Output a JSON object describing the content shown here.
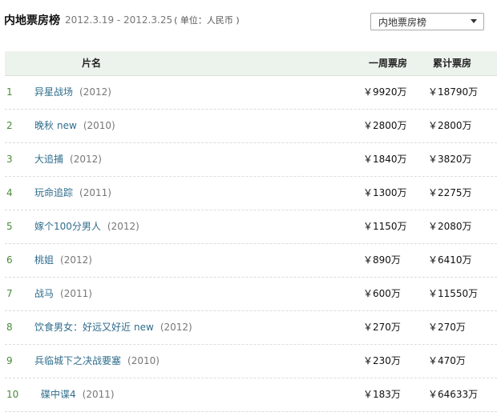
{
  "header": {
    "title": "内地票房榜",
    "dates": "2012.3.19 - 2012.3.25",
    "unit": "( 单位：人民币 )"
  },
  "selector": {
    "selected": "内地票房榜",
    "icon": "chevron-down-icon"
  },
  "table": {
    "columns": {
      "name": "片名",
      "week": "一周票房",
      "total": "累计票房"
    },
    "rows": [
      {
        "rank": "1",
        "title": "异星战场",
        "tag": "",
        "year": "(2012)",
        "week": "￥9920万",
        "total": "￥18790万"
      },
      {
        "rank": "2",
        "title": "晚秋",
        "tag": "new",
        "year": "(2010)",
        "week": "￥2800万",
        "total": "￥2800万"
      },
      {
        "rank": "3",
        "title": "大追捕",
        "tag": "",
        "year": "(2012)",
        "week": "￥1840万",
        "total": "￥3820万"
      },
      {
        "rank": "4",
        "title": "玩命追踪",
        "tag": "",
        "year": "(2011)",
        "week": "￥1300万",
        "total": "￥2275万"
      },
      {
        "rank": "5",
        "title": "嫁个100分男人",
        "tag": "",
        "year": "(2012)",
        "week": "￥1150万",
        "total": "￥2080万"
      },
      {
        "rank": "6",
        "title": "桃姐",
        "tag": "",
        "year": "(2012)",
        "week": "￥890万",
        "total": "￥6410万"
      },
      {
        "rank": "7",
        "title": "战马",
        "tag": "",
        "year": "(2011)",
        "week": "￥600万",
        "total": "￥11550万"
      },
      {
        "rank": "8",
        "title": "饮食男女：好远又好近",
        "tag": "new",
        "year": "(2012)",
        "week": "￥270万",
        "total": "￥270万"
      },
      {
        "rank": "9",
        "title": "兵临城下之决战要塞",
        "tag": "",
        "year": "(2010)",
        "week": "￥230万",
        "total": "￥470万"
      },
      {
        "rank": "10",
        "title": "碟中谍4",
        "tag": "",
        "year": "(2011)",
        "week": "￥183万",
        "total": "￥64633万"
      }
    ]
  }
}
